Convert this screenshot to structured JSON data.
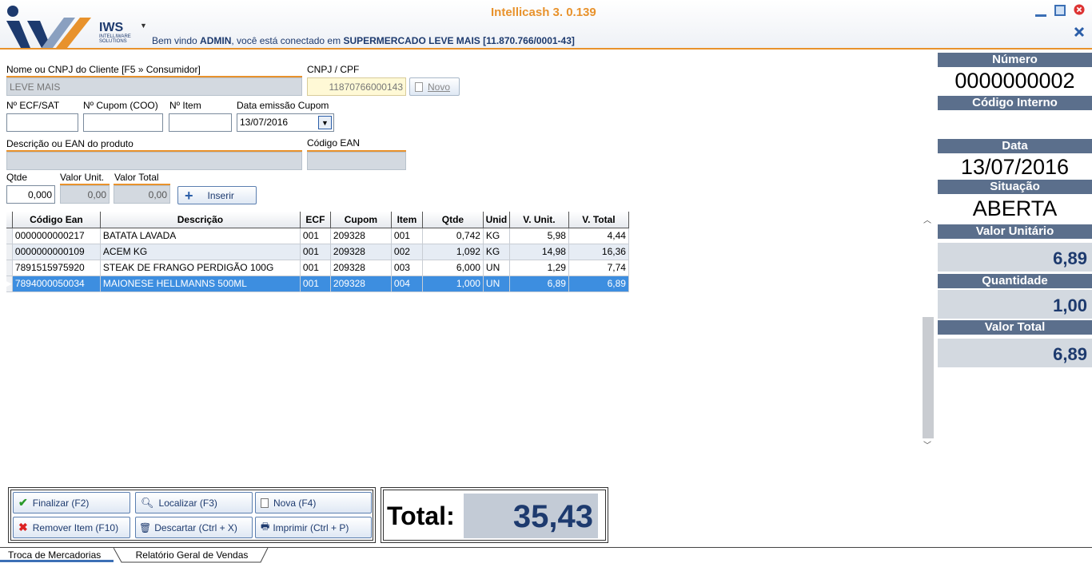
{
  "app": {
    "title": "Intellicash 3. 0.139",
    "logo_text": "IWS",
    "logo_sub": "INTELLIWARE SOLUTIONS",
    "welcome_prefix": "Bem vindo ",
    "user": "ADMIN",
    "welcome_mid": ", você está conectado em ",
    "company": "SUPERMERCADO LEVE MAIS [11.870.766/0001-43]"
  },
  "form": {
    "client_label": "Nome ou CNPJ do Cliente [F5 » Consumidor]",
    "client_value": "LEVE MAIS",
    "cnpj_label": "CNPJ / CPF",
    "cnpj_value": "11870766000143",
    "novo_label": "Novo",
    "ecf_label": "Nº ECF/SAT",
    "ecf_value": "",
    "cupom_label": "Nº Cupom (COO)",
    "cupom_value": "",
    "item_label": "Nº Item",
    "item_value": "",
    "data_label": "Data emissão Cupom",
    "data_value": "13/07/2016",
    "desc_label": "Descrição ou EAN do produto",
    "desc_value": "",
    "ean_label": "Código EAN",
    "ean_value": "",
    "qtde_label": "Qtde",
    "qtde_value": "0,000",
    "vunit_label": "Valor Unit.",
    "vunit_value": "0,00",
    "vtotal_label": "Valor Total",
    "vtotal_value": "0,00",
    "inserir_label": "Inserir"
  },
  "grid": {
    "columns": [
      "Código Ean",
      "Descrição",
      "ECF",
      "Cupom",
      "Item",
      "Qtde",
      "Unid",
      "V. Unit.",
      "V. Total"
    ],
    "rows": [
      [
        "0000000000217",
        "BATATA LAVADA",
        "001",
        "209328",
        "001",
        "0,742",
        "KG",
        "5,98",
        "4,44"
      ],
      [
        "0000000000109",
        "ACEM KG",
        "001",
        "209328",
        "002",
        "1,092",
        "KG",
        "14,98",
        "16,36"
      ],
      [
        "7891515975920",
        "STEAK DE FRANGO PERDIGÃO 100G",
        "001",
        "209328",
        "003",
        "6,000",
        "UN",
        "1,29",
        "7,74"
      ],
      [
        "7894000050034",
        "MAIONESE HELLMANNS 500ML",
        "001",
        "209328",
        "004",
        "1,000",
        "UN",
        "6,89",
        "6,89"
      ]
    ],
    "selected_row": 3
  },
  "panel": {
    "numero_label": "Número",
    "numero_value": "0000000002",
    "codigo_label": "Código Interno",
    "data_label": "Data",
    "data_value": "13/07/2016",
    "situacao_label": "Situação",
    "situacao_value": "ABERTA",
    "vunit_label": "Valor Unitário",
    "vunit_value": "6,89",
    "qtd_label": "Quantidade",
    "qtd_value": "1,00",
    "vtotal_label": "Valor Total",
    "vtotal_value": "6,89"
  },
  "actions": {
    "finalizar": "Finalizar (F2)",
    "localizar": "Localizar (F3)",
    "nova": "Nova (F4)",
    "remover": "Remover Item (F10)",
    "descartar": "Descartar (Ctrl + X)",
    "imprimir": "Imprimir (Ctrl + P)"
  },
  "total": {
    "label": "Total:",
    "value": "35,43"
  },
  "tabs": [
    "Troca de Mercadorias",
    "Relatório Geral de Vendas"
  ],
  "colors": {
    "accent": "#e8922c",
    "navy": "#1d3a6e",
    "selected": "#3d8ee0"
  }
}
